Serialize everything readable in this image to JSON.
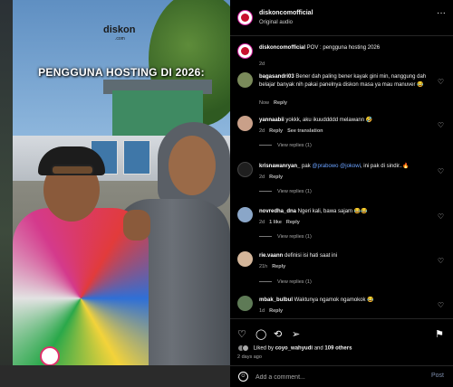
{
  "media": {
    "watermark": "diskon",
    "watermark_sub": ".com",
    "overlay_title": "PENGGUNA HOSTING DI 2026:"
  },
  "header": {
    "username": "diskoncomofficial",
    "audio": "Original audio"
  },
  "caption": {
    "username": "diskoncomofficial",
    "text": " POV : pengguna hosting 2026",
    "time": "2d"
  },
  "comments": [
    {
      "user": "bagasandri03",
      "text": " Bener dah paling bener kayak gini min, nanggung dah belajar banyak nih pakai panelnya diskon masa ya mau manuver 😂",
      "time": "Now",
      "reply": "Reply"
    },
    {
      "user": "yannaabii",
      "text": " yokkk, aku ikuuddddd melawann 🤣",
      "time": "2d",
      "reply": "Reply",
      "translation": "See translation",
      "view_replies": "View replies (1)"
    },
    {
      "user": "krisnawanryan_",
      "text_pre": " pak ",
      "mention1": "@prabowo",
      "mention2": "@jokowi",
      "text_post": ", ini pak di sindir..🔥",
      "time": "2d",
      "reply": "Reply",
      "view_replies": "View replies (1)"
    },
    {
      "user": "novredha_dna",
      "text": " Ngeri kali, bawa sajam 😂😂",
      "time": "2d",
      "likes": "1 like",
      "reply": "Reply",
      "view_replies": "View replies (1)"
    },
    {
      "user": "rie.vaann",
      "text": " definisi isi hati saat ini",
      "time": "21h",
      "reply": "Reply",
      "view_replies": "View replies (1)"
    },
    {
      "user": "mbak_bulbul",
      "text": " Waktunya ngamok ngamokok 😂",
      "time": "1d",
      "reply": "Reply"
    }
  ],
  "likes": {
    "prefix": "Liked by ",
    "user": "coyo_wahyudi",
    "middle": " and ",
    "count": "109 others"
  },
  "posted_ago": "2 days ago",
  "add_comment": {
    "placeholder": "Add a comment...",
    "post_label": "Post"
  },
  "icons": {
    "like": "heart-icon",
    "comment": "comment-icon",
    "share": "repost-icon",
    "send": "send-icon",
    "save": "bookmark-icon"
  }
}
